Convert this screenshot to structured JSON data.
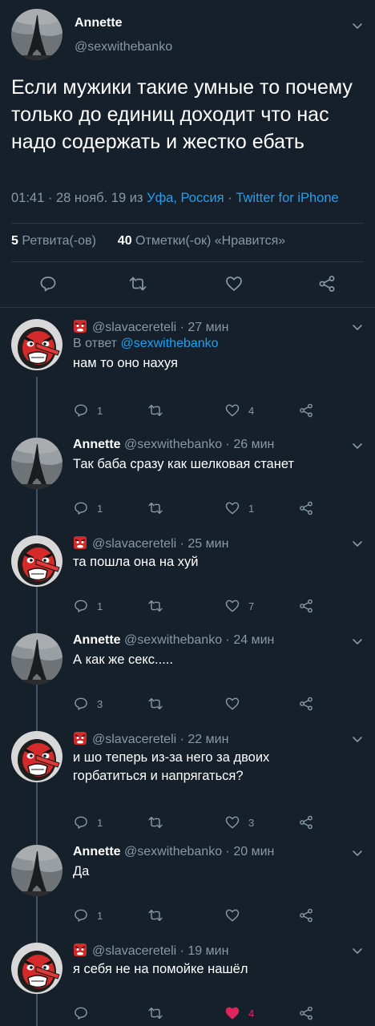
{
  "colors": {
    "background": "#15202b",
    "text": "#ffffff",
    "muted": "#8899a6",
    "link": "#1da1f2",
    "like_active": "#e0245e"
  },
  "main_tweet": {
    "author_name": "Annette",
    "author_handle": "@sexwithebanko",
    "text": "Если мужики такие умные то почему только до единиц доходит что нас надо содержать и жестко ебать",
    "time": "01:41",
    "date": "28 нояб. 19",
    "from_word": "из",
    "location": "Уфа, Россия",
    "source": "Twitter for iPhone",
    "retweets_count": "5",
    "retweets_label": "Ретвита(-ов)",
    "likes_count": "40",
    "likes_label": "Отметки(-ок) «Нравится»"
  },
  "replies": [
    {
      "author_name": "",
      "author_handle": "@slavacereteli",
      "time": "27 мин",
      "reply_to_prefix": "В ответ",
      "reply_to_handle": "@sexwithebanko",
      "text": "нам то оно нахуя",
      "reply_count": "1",
      "retweet_count": "",
      "like_count": "4"
    },
    {
      "author_name": "Annette",
      "author_handle": "@sexwithebanko",
      "time": "26 мин",
      "text": "Так баба сразу как шелковая станет",
      "reply_count": "1",
      "retweet_count": "",
      "like_count": "1"
    },
    {
      "author_name": "",
      "author_handle": "@slavacereteli",
      "time": "25 мин",
      "text": "та пошла она на хуй",
      "reply_count": "1",
      "retweet_count": "",
      "like_count": "7"
    },
    {
      "author_name": "Annette",
      "author_handle": "@sexwithebanko",
      "time": "24 мин",
      "text": "А как же секс.....",
      "reply_count": "3",
      "retweet_count": "",
      "like_count": ""
    },
    {
      "author_name": "",
      "author_handle": "@slavacereteli",
      "time": "22 мин",
      "text": "и шо теперь из-за него за двоих горбатиться и напрягаться?",
      "reply_count": "1",
      "retweet_count": "",
      "like_count": "3"
    },
    {
      "author_name": "Annette",
      "author_handle": "@sexwithebanko",
      "time": "20 мин",
      "text": "Да",
      "reply_count": "1",
      "retweet_count": "",
      "like_count": ""
    },
    {
      "author_name": "",
      "author_handle": "@slavacereteli",
      "time": "19 мин",
      "text": "я себя не на помойке нашёл",
      "reply_count": "",
      "retweet_count": "",
      "like_count": "4",
      "liked": true
    }
  ],
  "icons": {
    "reply": "speech-bubble-icon",
    "retweet": "retweet-arrows-icon",
    "like": "heart-icon",
    "share": "share-nodes-icon",
    "caret": "chevron-down-icon"
  }
}
